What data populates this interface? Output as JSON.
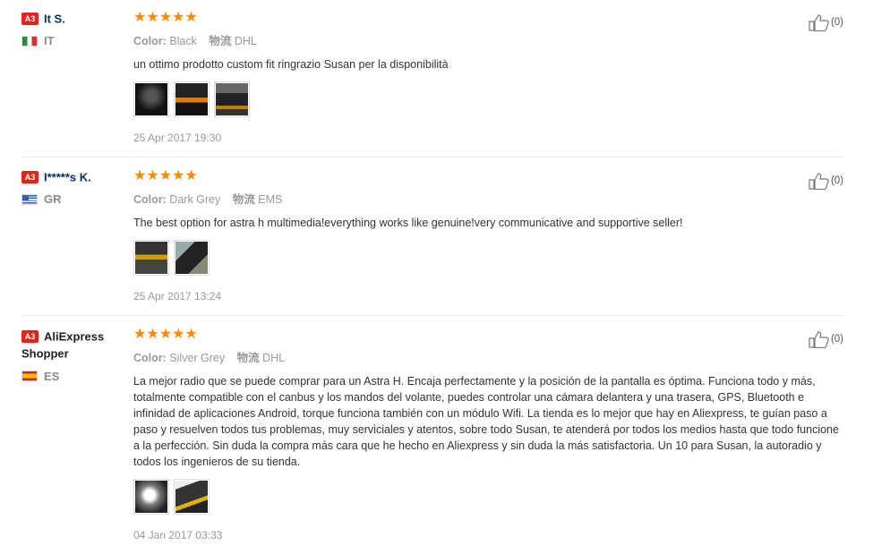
{
  "reviews": [
    {
      "level": "A3",
      "name": "It S.",
      "country": "IT",
      "stars": "★★★★★",
      "color_label": "Color:",
      "color_value": "Black",
      "logistics_label": "物流",
      "logistics_value": "DHL",
      "text": "un ottimo prodotto custom fit ringrazio Susan per la disponibilità",
      "date": "25 Apr 2017 19:30",
      "likes": "(0)"
    },
    {
      "level": "A3",
      "name": "I*****s K.",
      "country": "GR",
      "stars": "★★★★★",
      "color_label": "Color:",
      "color_value": "Dark Grey",
      "logistics_label": "物流",
      "logistics_value": "EMS",
      "text": "The best option for astra h multimedia!everything works like genuine!very communicative and supportive seller!",
      "date": "25 Apr 2017 13:24",
      "likes": "(0)"
    },
    {
      "level": "A3",
      "name": "AliExpress Shopper",
      "country": "ES",
      "stars": "★★★★★",
      "color_label": "Color:",
      "color_value": "Silver Grey",
      "logistics_label": "物流",
      "logistics_value": "DHL",
      "text": "La mejor radio que se puede comprar para un Astra H. Encaja perfectamente y la posición de la pantalla es óptima. Funciona todo y más, totalmente compatible con el canbus y los mandos del volante, puedes controlar una cámara delantera y una trasera, GPS, Bluetooth e infinidad de aplicaciones Android, torque funciona también con un módulo Wifi. La tienda es lo mejor que hay en Aliexpress, te guían paso a paso y resuelven todos tus problemas, muy serviciales y atentos, sobre todo Susan, te atenderá por todos los medios hasta que todo funcione a la perfección. Sin duda la compra más cara que he hecho en Aliexpress y sin duda la más satisfactoria. Un 10 para Susan, la autoradio y todos los ingenieros de su tienda.",
      "date": "04 Jan 2017 03:33",
      "likes": "(0)"
    }
  ],
  "icons": {
    "like": "thumbs-up-icon",
    "star": "star-icon"
  },
  "colors": {
    "star": "#ff8a00",
    "level_badge": "#e1251b",
    "username": "#003366"
  }
}
